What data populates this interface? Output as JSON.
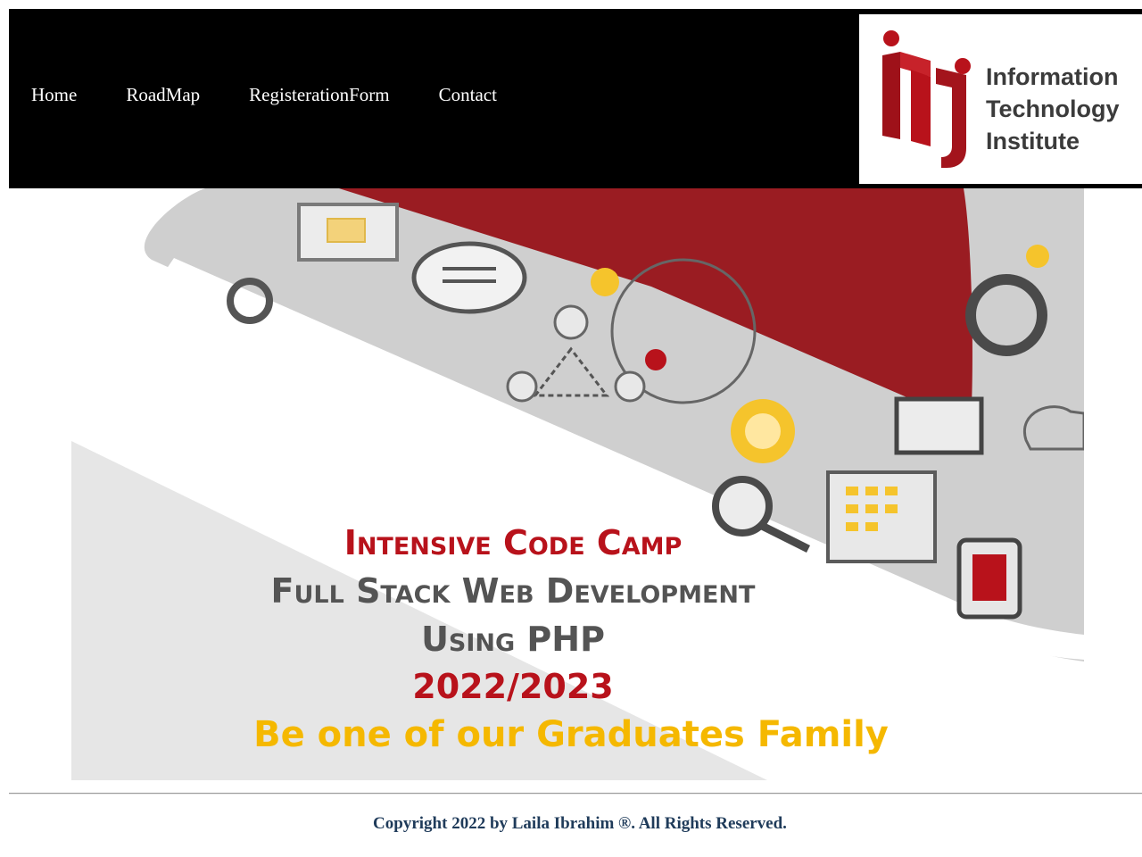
{
  "nav": {
    "items": [
      "Home",
      "RoadMap",
      "RegisterationForm",
      "Contact"
    ]
  },
  "logo": {
    "line1": "Information",
    "line2": "Technology",
    "line3": "Institute",
    "brand_color": "#b8121b"
  },
  "banner": {
    "line1": "Intensive Code Camp",
    "line2": "Full Stack Web Development",
    "line3": "Using PHP",
    "line4": "2022/2023",
    "line5": "Be one of our Graduates Family"
  },
  "footer": {
    "copyright": "Copyright 2022 by Laila Ibrahim ®. All Rights Reserved."
  }
}
